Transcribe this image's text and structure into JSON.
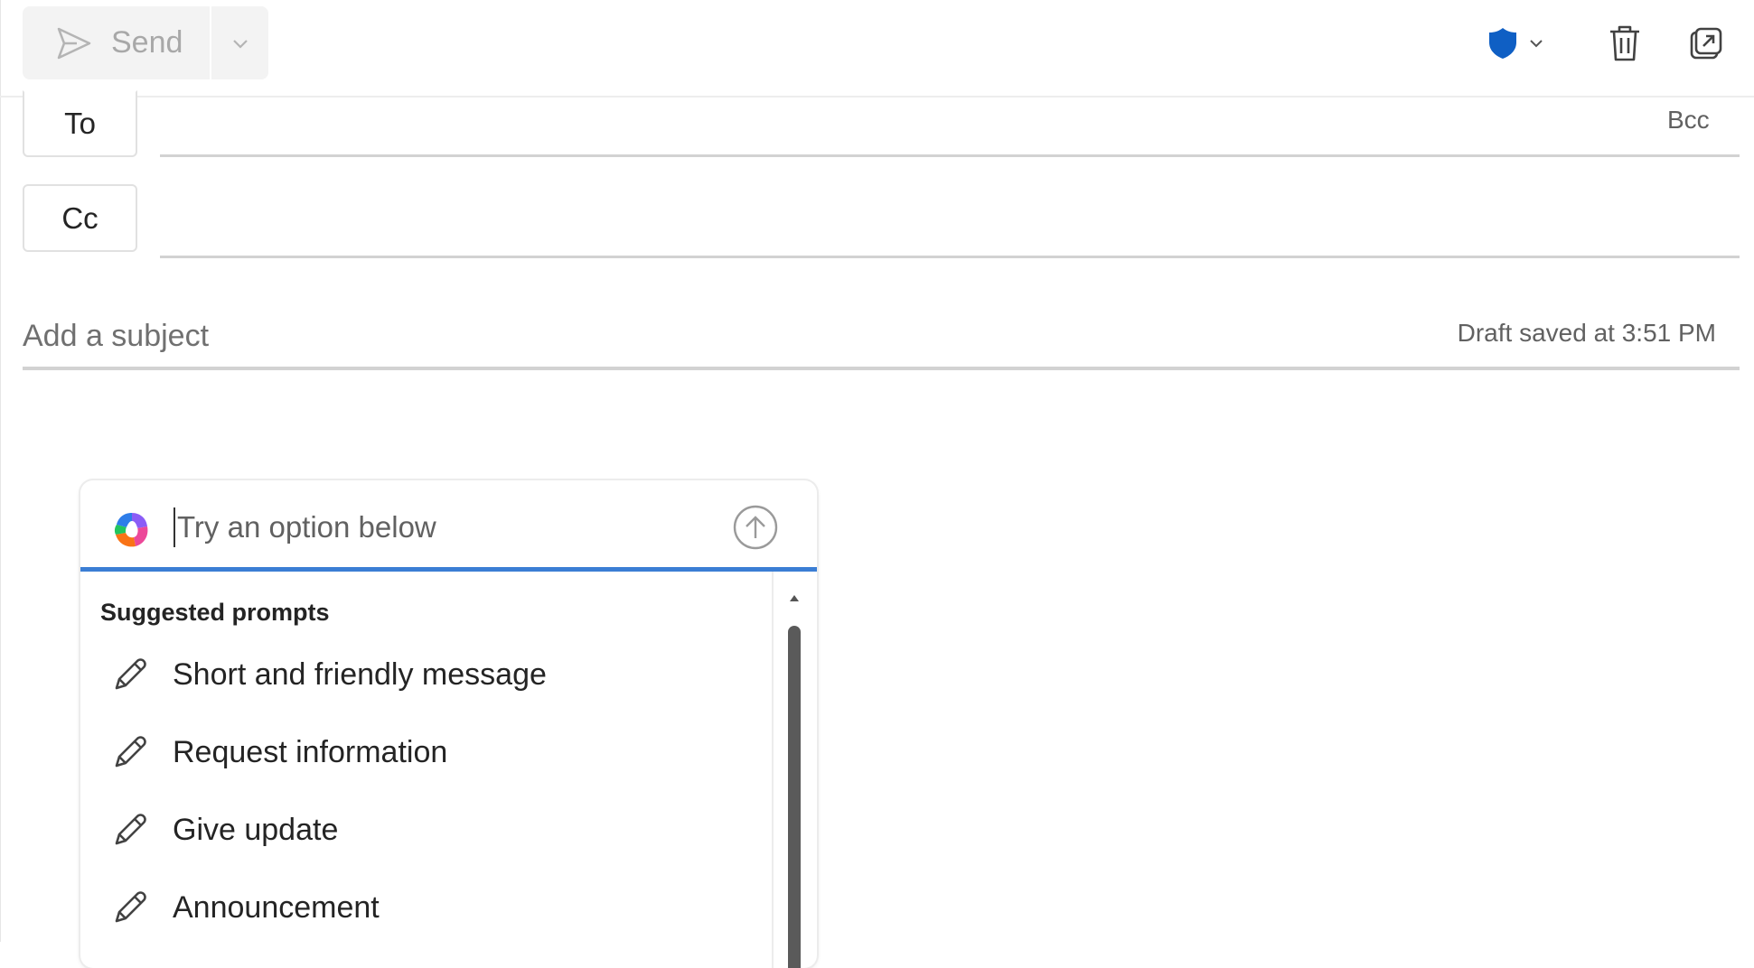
{
  "toolbar": {
    "send_label": "Send",
    "icons": {
      "send": "send-icon",
      "send_options": "chevron-down-icon",
      "sensitivity": "shield-icon",
      "discard": "trash-icon",
      "popout": "popout-icon"
    },
    "colors": {
      "shield": "#0f5fc4",
      "send_disabled": "#a8a8a8"
    }
  },
  "recipients": {
    "to_label": "To",
    "cc_label": "Cc",
    "bcc_label": "Bcc",
    "to_value": "",
    "cc_value": ""
  },
  "subject": {
    "placeholder": "Add a subject",
    "value": "",
    "draft_status": "Draft saved at 3:51 PM"
  },
  "copilot": {
    "input_placeholder": "Try an option below",
    "accent_color": "#3b7ed4",
    "suggested_header": "Suggested prompts",
    "prompts": [
      {
        "label": "Short and friendly message",
        "icon": "pencil-icon"
      },
      {
        "label": "Request information",
        "icon": "pencil-icon"
      },
      {
        "label": "Give update",
        "icon": "pencil-icon"
      },
      {
        "label": "Announcement",
        "icon": "pencil-icon"
      }
    ]
  }
}
